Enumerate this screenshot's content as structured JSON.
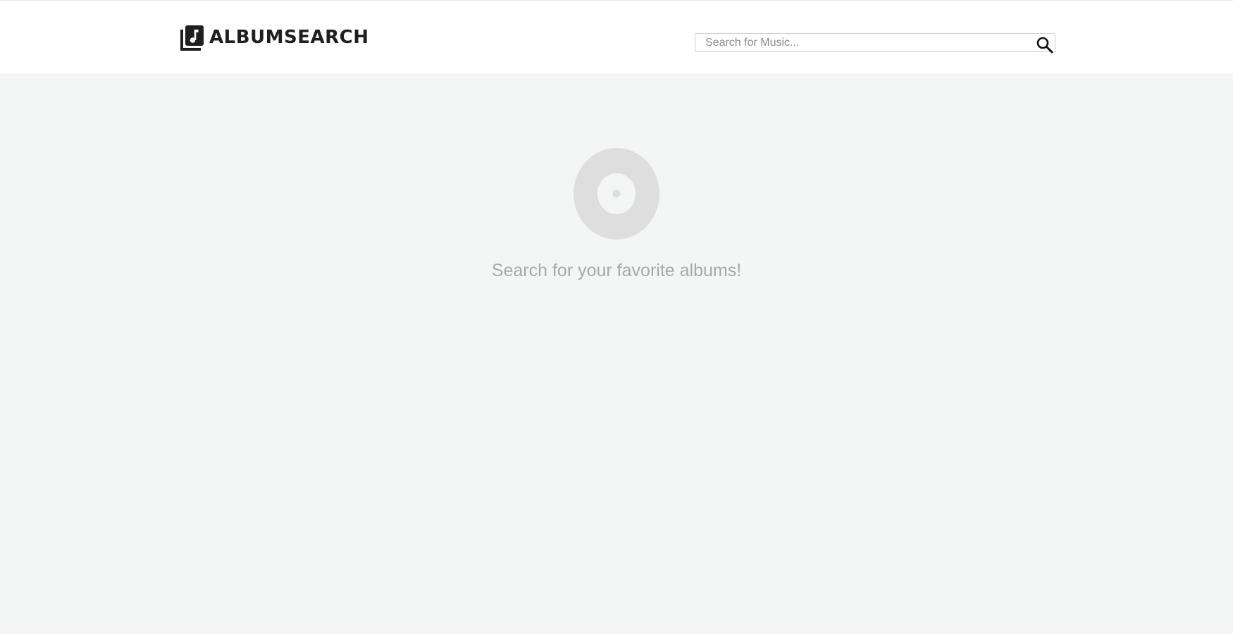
{
  "header": {
    "logo_text": "ALBUMSEARCH",
    "logo_icon": "music-library-icon",
    "search": {
      "placeholder": "Search for Music...",
      "value": "",
      "button_icon": "search-icon"
    }
  },
  "main": {
    "empty_icon": "vinyl-disc-icon",
    "empty_message": "Search for your favorite albums!"
  },
  "colors": {
    "header_bg": "#ffffff",
    "page_bg": "#f4f5f5",
    "logo_text": "#1f1f1f",
    "disc": "#dedede",
    "message_text": "#a9a9a9"
  }
}
